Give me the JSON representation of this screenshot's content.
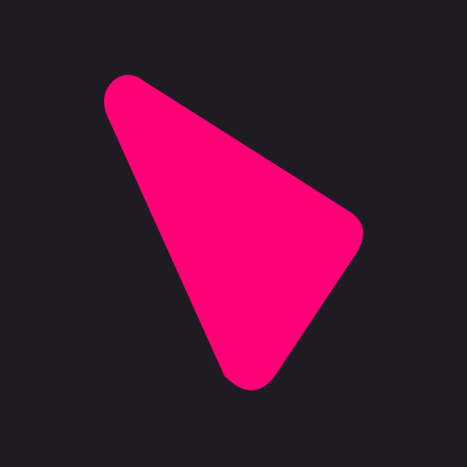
{
  "colors": {
    "background": "#1e1c22",
    "shape": "#ff0077"
  },
  "icon": {
    "name": "pink-rounded-triangle-icon"
  }
}
